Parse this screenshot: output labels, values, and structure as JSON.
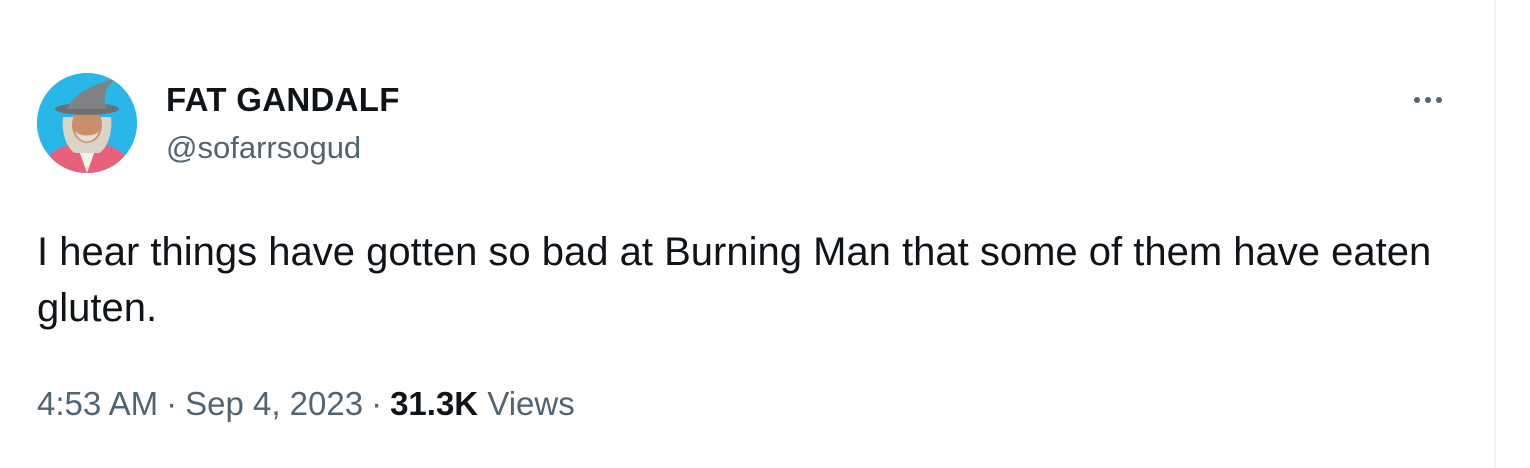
{
  "author": {
    "display_name": "FAT GANDALF",
    "handle": "@sofarrsogud",
    "avatar_icon": "avatar-wizard-hat-icon"
  },
  "more_icon": "more-horizontal-icon",
  "tweet": {
    "text": "I hear things have gotten so bad at Burning Man that some of them have eaten gluten."
  },
  "meta": {
    "time": "4:53 AM",
    "separator": "·",
    "date": "Sep 4, 2023",
    "views_count": "31.3K",
    "views_label": "Views"
  },
  "colors": {
    "text_primary": "#0f1419",
    "text_secondary": "#536471",
    "avatar_background": "#29b6e8"
  }
}
